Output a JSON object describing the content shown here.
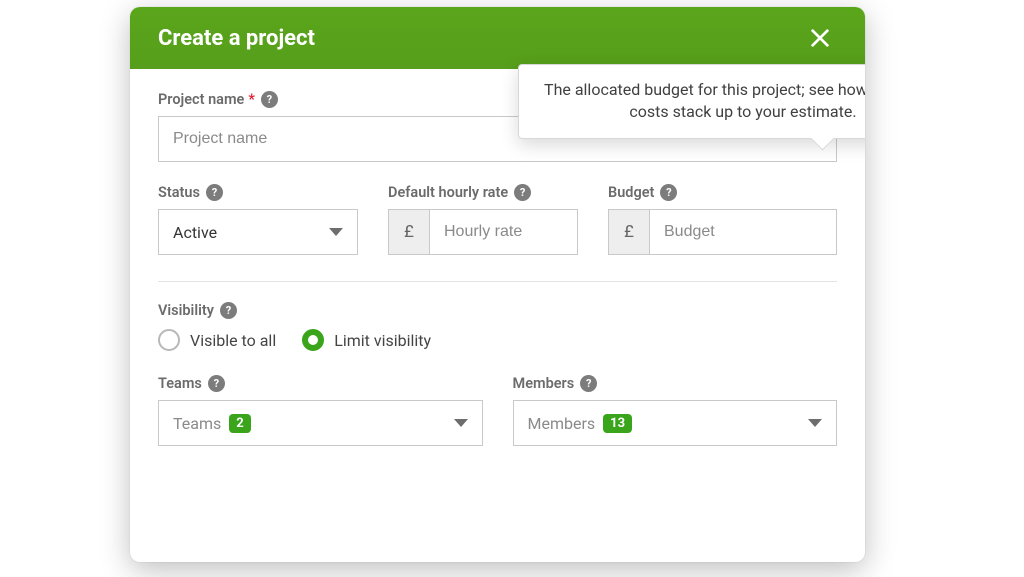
{
  "header": {
    "title": "Create a project",
    "close_icon": "close"
  },
  "project_name": {
    "label": "Project name",
    "required": "*",
    "placeholder": "Project name"
  },
  "status": {
    "label": "Status",
    "value": "Active"
  },
  "hourly_rate": {
    "label": "Default hourly rate",
    "currency_symbol": "£",
    "placeholder": "Hourly rate"
  },
  "budget": {
    "label": "Budget",
    "currency_symbol": "£",
    "placeholder": "Budget",
    "tooltip": "The allocated budget for this project; see how the actual costs stack up to your estimate."
  },
  "visibility": {
    "label": "Visibility",
    "option_all": "Visible to all",
    "option_limit": "Limit visibility",
    "selected": "limit"
  },
  "teams": {
    "label": "Teams",
    "select_label": "Teams",
    "count": "2"
  },
  "members": {
    "label": "Members",
    "select_label": "Members",
    "count": "13"
  },
  "help_glyph": "?"
}
